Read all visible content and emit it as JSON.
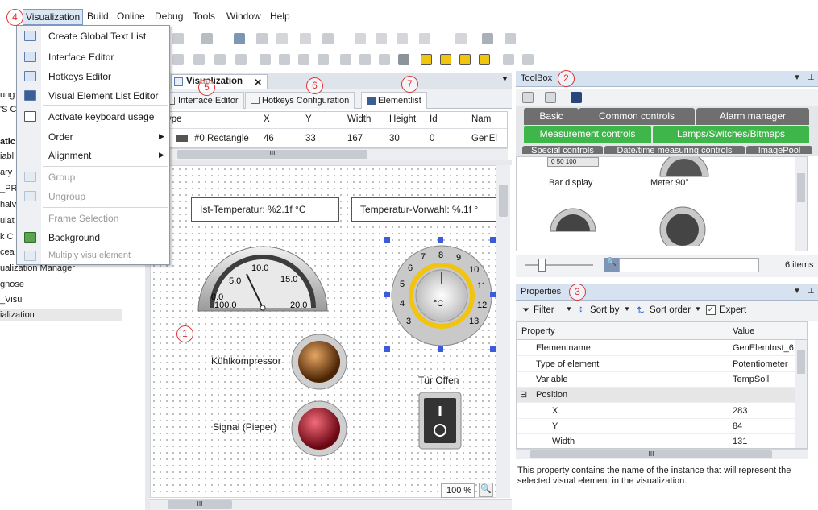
{
  "menubar": {
    "items": [
      "Visualization",
      "Build",
      "Online",
      "Debug",
      "Tools",
      "Window",
      "Help"
    ]
  },
  "vis_menu": {
    "items": [
      {
        "label": "Create Global Text List",
        "disabled": false
      },
      {
        "label": "Interface Editor",
        "disabled": false
      },
      {
        "label": "Hotkeys Editor",
        "disabled": false
      },
      {
        "label": "Visual Element List Editor",
        "disabled": false
      },
      {
        "label": "Activate keyboard usage",
        "disabled": false
      },
      {
        "label": "Order",
        "disabled": false,
        "submenu": true
      },
      {
        "label": "Alignment",
        "disabled": false,
        "submenu": true
      },
      {
        "label": "Group",
        "disabled": true
      },
      {
        "label": "Ungroup",
        "disabled": true
      },
      {
        "label": "Frame Selection",
        "disabled": true
      },
      {
        "label": "Background",
        "disabled": false
      },
      {
        "label": "Multiply visu element",
        "disabled": true
      }
    ]
  },
  "tree": {
    "items": [
      "ung",
      "'S C",
      "atic",
      "iabl",
      "ary",
      "_PR",
      "halv",
      "ulat",
      "k C",
      "cea",
      "ualization Manager",
      "gnose",
      "_Visu",
      "ialization"
    ]
  },
  "editor": {
    "doc_tab": "Visualization",
    "doc_tab_close": "✕",
    "subtabs": [
      "Interface Editor",
      "Hotkeys Configuration",
      "Elementlist"
    ],
    "columns": [
      "ype",
      "X",
      "Y",
      "Width",
      "Height",
      "Id",
      "Nam"
    ],
    "row": {
      "type": "#0 Rectangle",
      "x": "46",
      "y": "33",
      "width": "167",
      "height": "30",
      "id": "0",
      "name": "GenEl"
    },
    "scroll_grip": "III",
    "bottom_scroll_grip": "III",
    "zoom": "100 %"
  },
  "canvas": {
    "text_fields": [
      "Ist-Temperatur: %2.1f °C",
      "Temperatur-Vorwahl: %.1f °"
    ],
    "meter_labels": [
      "10.0",
      "15.0",
      "5.0",
      "20.0",
      "0.0",
      "100.0"
    ],
    "dial_numbers": [
      "8",
      "9",
      "10",
      "11",
      "12",
      "13",
      "7",
      "6",
      "5",
      "4",
      "3"
    ],
    "dial_unit": "°C",
    "labels": {
      "compressor": "Kühlkompressor",
      "signal": "Signal (Pieper)",
      "door": "Tür Offen"
    }
  },
  "toolbox": {
    "title": "ToolBox",
    "tabs_row1": [
      "Basic",
      "Common controls",
      "Alarm manager"
    ],
    "tabs_row2": [
      "Measurement controls",
      "Lamps/Switches/Bitmaps"
    ],
    "tabs_row3": [
      "Special controls",
      "Date/time measuring controls",
      "ImagePool"
    ],
    "items": [
      "Bar display",
      "Meter 90°"
    ],
    "bar_scale": "0  50  100",
    "count": "6 items"
  },
  "properties": {
    "title": "Properties",
    "filter_label": "Filter",
    "sortby_label": "Sort by",
    "sortorder_label": "Sort order",
    "expert_label": "Expert",
    "col_property": "Property",
    "col_value": "Value",
    "rows": [
      {
        "name": "Elementname",
        "value": "GenElemInst_6"
      },
      {
        "name": "Type of element",
        "value": "Potentiometer"
      },
      {
        "name": "Variable",
        "value": "TempSoll"
      },
      {
        "name": "Position",
        "value": ""
      },
      {
        "name": "X",
        "value": "283"
      },
      {
        "name": "Y",
        "value": "84"
      },
      {
        "name": "Width",
        "value": "131"
      }
    ],
    "collapse_glyph": "⊟",
    "scroll_grip": "III",
    "description": "This property contains the name of the instance that will represent the selected visual element in the visualization."
  },
  "callouts": [
    "1",
    "2",
    "3",
    "4",
    "5",
    "6",
    "7"
  ],
  "colors": {
    "green_tab": "#3fb64a",
    "grey_tab": "#6f6f6f",
    "callout": "#dd3333",
    "panel_header": "#d6e2f0"
  }
}
